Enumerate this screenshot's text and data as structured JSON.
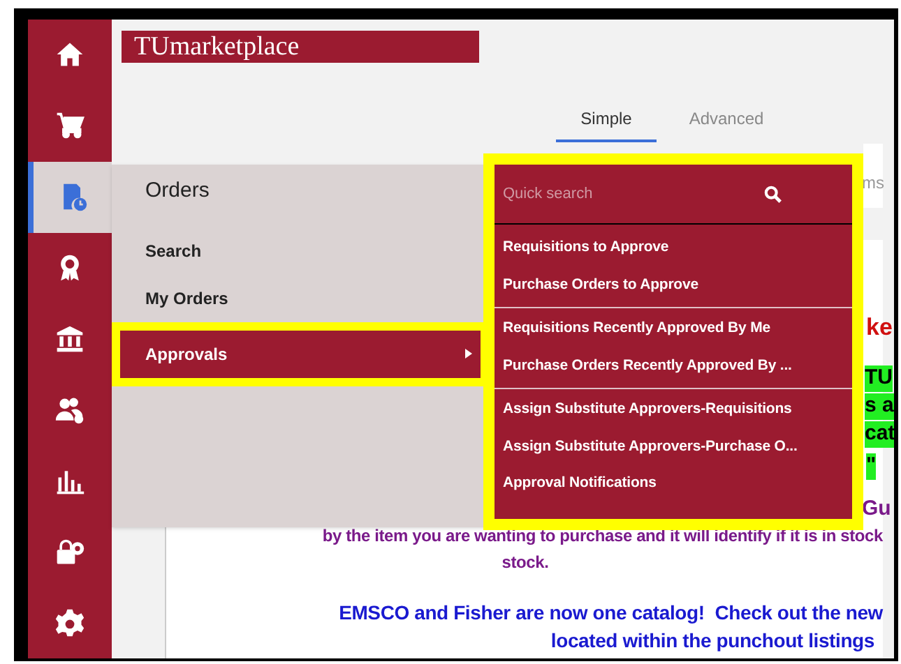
{
  "sidebar": {
    "items": [
      {
        "kind": "home",
        "selected": false
      },
      {
        "kind": "cart",
        "selected": false
      },
      {
        "kind": "orders",
        "selected": true
      },
      {
        "kind": "award",
        "selected": false
      },
      {
        "kind": "bank",
        "selected": false
      },
      {
        "kind": "people",
        "selected": false
      },
      {
        "kind": "chart",
        "selected": false
      },
      {
        "kind": "lock-gear",
        "selected": false
      },
      {
        "kind": "gear",
        "selected": false
      }
    ]
  },
  "logo": "TUmarketplace",
  "tabs": [
    {
      "label": "Simple",
      "selected": true
    },
    {
      "label": "Advanced",
      "selected": false
    }
  ],
  "background_fragments": [
    {
      "kind": "grey",
      "text": "ms"
    },
    {
      "kind": "red",
      "text": "ke"
    },
    {
      "kind": "green",
      "text": "TU"
    },
    {
      "kind": "green",
      "text": "s a"
    },
    {
      "kind": "green",
      "text": "cat"
    },
    {
      "kind": "green",
      "text": "\""
    },
    {
      "kind": "purple",
      "text": "Gu"
    }
  ],
  "notice": {
    "purple_lines": [
      "by the item you are wanting to purchase and it will identify if it is in stock",
      "stock."
    ],
    "blue_lines": [
      "EMSCO and Fisher are now one catalog!  Check out the new",
      "located within the punchout listings"
    ]
  },
  "flyout": {
    "title": "Orders",
    "items": [
      {
        "label": "Search",
        "selected": false,
        "submenu": false,
        "highlighted": false
      },
      {
        "label": "My Orders",
        "selected": false,
        "submenu": false,
        "highlighted": false
      },
      {
        "label": "Approvals",
        "selected": true,
        "submenu": true,
        "highlighted": true
      }
    ]
  },
  "submenu": {
    "highlighted": true,
    "search": {
      "placeholder": "Quick search"
    },
    "groups": [
      [
        "Requisitions to Approve",
        "Purchase Orders to Approve"
      ],
      [
        "Requisitions Recently Approved By Me",
        "Purchase Orders Recently Approved By ..."
      ],
      [
        "Assign Substitute Approvers-Requisitions",
        "Assign Substitute Approvers-Purchase O...",
        "Approval Notifications"
      ]
    ]
  }
}
